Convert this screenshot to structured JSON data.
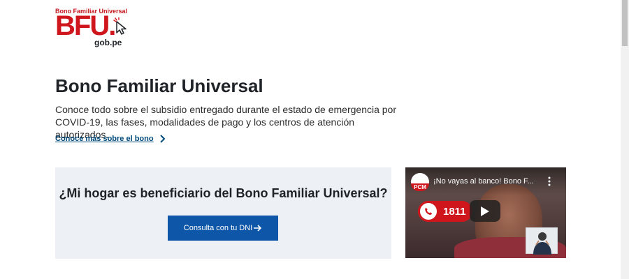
{
  "logo": {
    "top_text": "Bono Familiar Universal",
    "main_text": "BFU.",
    "sub_text": "gob.pe"
  },
  "hero": {
    "title": "Bono Familiar Universal",
    "description": "Conoce todo sobre el subsidio entregado durante el estado de emergencia por COVID-19, las fases, modalidades de pago y los centros de atención autorizados.",
    "link_label": "Conoce más sobre el bono"
  },
  "consulta": {
    "question": "¿Mi hogar es beneficiario del Bono Familiar Universal?",
    "button_label": "Consulta con tu DNI"
  },
  "video": {
    "channel_label": "PCM",
    "title": "¡No vayas al banco! Bono F...",
    "badge_number": "1811"
  },
  "colors": {
    "brand_red": "#d0161d",
    "primary_blue": "#0d56a8",
    "link_blue": "#004a7c",
    "panel_bg": "#edf0f5"
  },
  "icons": {
    "cursor": "cursor-click-icon",
    "chevron": "chevron-right-icon",
    "arrow": "arrow-right-icon",
    "play": "play-icon",
    "menu": "kebab-menu-icon",
    "phone": "phone-icon"
  }
}
